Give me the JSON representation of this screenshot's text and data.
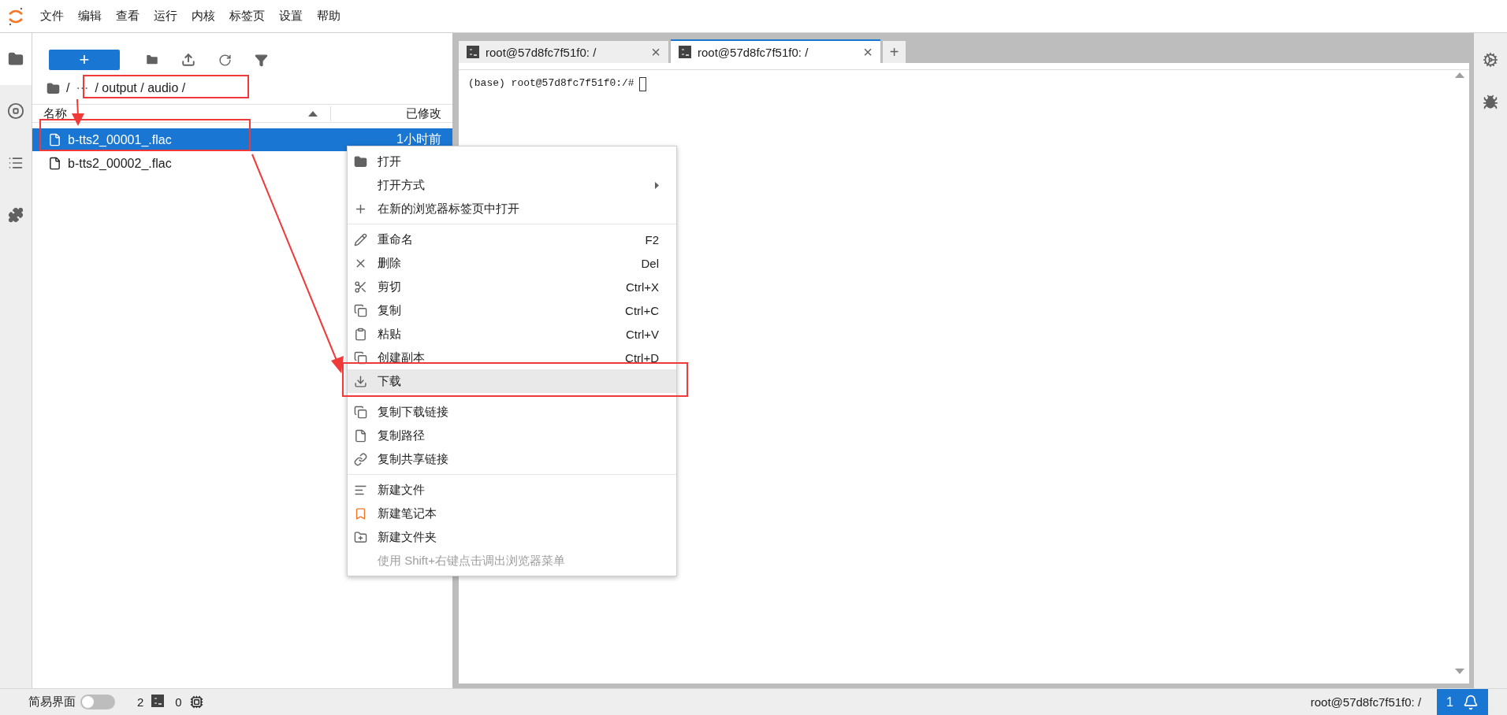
{
  "menu_bar": [
    "文件",
    "编辑",
    "查看",
    "运行",
    "内核",
    "标签页",
    "设置",
    "帮助"
  ],
  "left_sidebar": [
    {
      "selected": true
    },
    {
      "selected": false
    },
    {
      "selected": false
    },
    {
      "selected": false
    }
  ],
  "file_browser": {
    "new_button": "+",
    "breadcrumb": {
      "root": "/",
      "ellipsis": "···",
      "path": "/ output / audio /"
    },
    "columns": [
      "名称",
      "已修改"
    ],
    "rows": [
      {
        "name": "b-tts2_00001_.flac",
        "modified": "1小时前",
        "selected": true
      },
      {
        "name": "b-tts2_00002_.flac",
        "modified": "",
        "selected": false
      }
    ]
  },
  "tabs": [
    {
      "label": "root@57d8fc7f51f0: /",
      "selected": false,
      "close": "×"
    },
    {
      "label": "root@57d8fc7f51f0: /",
      "selected": true,
      "close": "×"
    }
  ],
  "new_tab": "+",
  "terminal": {
    "prompt": "(base) root@57d8fc7f51f0:/#"
  },
  "context_menu": [
    [
      {
        "label": "打开",
        "selected": false,
        "disabled": false
      },
      {
        "label": "打开方式",
        "selected": false,
        "disabled": false,
        "submenu": true
      },
      {
        "label": "在新的浏览器标签页中打开",
        "selected": false,
        "disabled": false
      }
    ],
    [
      {
        "label": "重命名",
        "shortcut": "F2",
        "selected": false,
        "disabled": false
      },
      {
        "label": "删除",
        "shortcut": "Del",
        "selected": false,
        "disabled": false
      },
      {
        "label": "剪切",
        "shortcut": "Ctrl+X",
        "selected": false,
        "disabled": false
      },
      {
        "label": "复制",
        "shortcut": "Ctrl+C",
        "selected": false,
        "disabled": false
      },
      {
        "label": "粘贴",
        "shortcut": "Ctrl+V",
        "selected": false,
        "disabled": false
      },
      {
        "label": "创建副本",
        "shortcut": "Ctrl+D",
        "selected": false,
        "disabled": false
      },
      {
        "label": "下载",
        "selected": true,
        "disabled": false
      }
    ],
    [
      {
        "label": "复制下载链接",
        "selected": false,
        "disabled": false
      },
      {
        "label": "复制路径",
        "selected": false,
        "disabled": false
      },
      {
        "label": "复制共享链接",
        "selected": false,
        "disabled": false
      }
    ],
    [
      {
        "label": "新建文件",
        "selected": false,
        "disabled": false
      },
      {
        "label": "新建笔记本",
        "selected": false,
        "disabled": false
      },
      {
        "label": "新建文件夹",
        "selected": false,
        "disabled": false
      },
      {
        "label": "使用 Shift+右键点击调出浏览器菜单",
        "selected": false,
        "disabled": true
      }
    ]
  ],
  "status_bar": {
    "simple_mode": {
      "label": "简易界面",
      "on": false
    },
    "terminals": "2",
    "kernels": "0",
    "right_text": "root@57d8fc7f51f0: /",
    "notifications": "1"
  }
}
